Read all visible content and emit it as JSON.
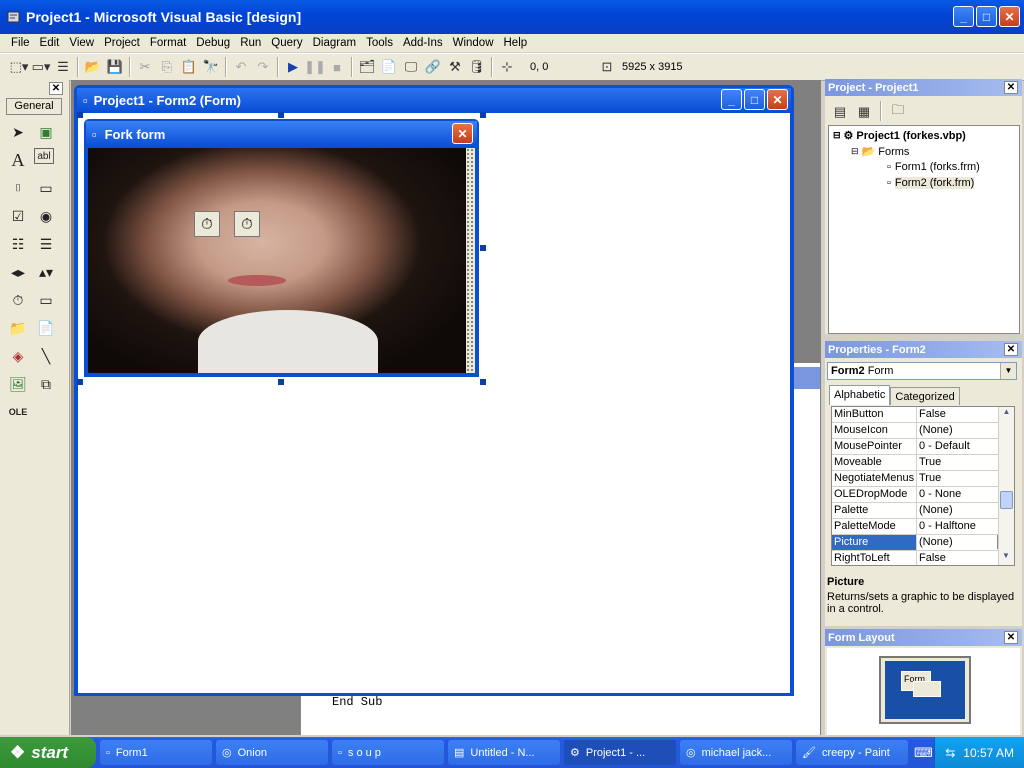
{
  "app": {
    "title": "Project1 - Microsoft Visual Basic [design]"
  },
  "menu": [
    "File",
    "Edit",
    "View",
    "Project",
    "Format",
    "Debug",
    "Run",
    "Query",
    "Diagram",
    "Tools",
    "Add-Ins",
    "Window",
    "Help"
  ],
  "toolbar": {
    "position": "0, 0",
    "size": "5925 x 3915"
  },
  "toolbox": {
    "tab_label": "General"
  },
  "form2_window": {
    "title": "Project1 - Form2 (Form)"
  },
  "fork_form": {
    "title": "Fork form"
  },
  "code": {
    "line": "End Sub"
  },
  "project_explorer": {
    "title": "Project - Project1",
    "root": "Project1 (forkes.vbp)",
    "folder": "Forms",
    "items": [
      "Form1 (forks.frm)",
      "Form2 (fork.frm)"
    ]
  },
  "properties": {
    "title": "Properties - Form2",
    "object_name": "Form2",
    "object_type": "Form",
    "tab_alphabetic": "Alphabetic",
    "tab_categorized": "Categorized",
    "rows": [
      {
        "key": "MinButton",
        "value": "False"
      },
      {
        "key": "MouseIcon",
        "value": "(None)"
      },
      {
        "key": "MousePointer",
        "value": "0 - Default"
      },
      {
        "key": "Moveable",
        "value": "True"
      },
      {
        "key": "NegotiateMenus",
        "value": "True"
      },
      {
        "key": "OLEDropMode",
        "value": "0 - None"
      },
      {
        "key": "Palette",
        "value": "(None)"
      },
      {
        "key": "PaletteMode",
        "value": "0 - Halftone"
      },
      {
        "key": "Picture",
        "value": "(None)"
      },
      {
        "key": "RightToLeft",
        "value": "False"
      }
    ],
    "desc_title": "Picture",
    "desc_text": "Returns/sets a graphic to be displayed in a control."
  },
  "form_layout": {
    "title": "Form Layout",
    "preview_label": "Form"
  },
  "taskbar": {
    "start": "start",
    "tasks": [
      "Form1",
      "Onion",
      "s o u p",
      "Untitled - N...",
      "Project1 - ...",
      "michael jack...",
      "creepy - Paint"
    ],
    "clock": "10:57 AM"
  }
}
